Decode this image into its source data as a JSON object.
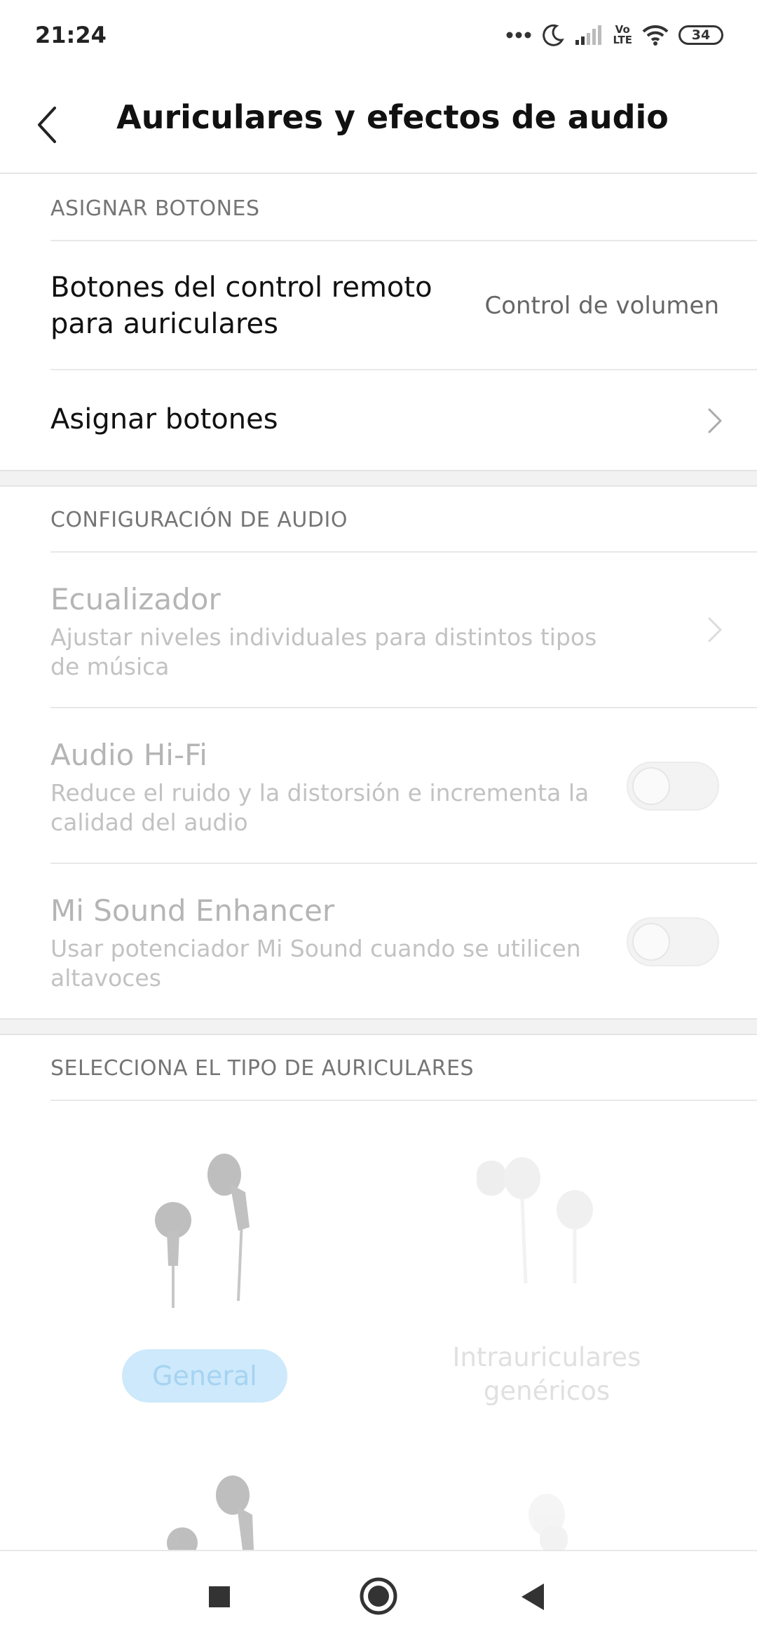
{
  "status_bar": {
    "time": "21:24",
    "volte_top": "Vo",
    "volte_bottom": "LTE",
    "battery": "34"
  },
  "app_bar": {
    "title": "Auriculares y efectos de audio",
    "back_icon": "chevron-left-icon"
  },
  "section_buttons": {
    "header": "ASIGNAR BOTONES",
    "remote_title_line1": "Botones del control remoto",
    "remote_title_line2": "para auriculares",
    "remote_value": "Control de volumen",
    "assign_title": "Asignar botones"
  },
  "section_audio": {
    "header": "CONFIGURACIÓN DE AUDIO",
    "equalizer": {
      "title": "Ecualizador",
      "subtitle": "Ajustar niveles individuales para distintos tipos de música"
    },
    "hifi": {
      "title": "Audio Hi-Fi",
      "subtitle": "Reduce el ruido y la distorsión e incrementa la calidad del audio",
      "enabled": false
    },
    "enhancer": {
      "title": "Mi Sound Enhancer",
      "subtitle": "Usar potenciador Mi Sound cuando se utilicen altavoces",
      "enabled": false
    }
  },
  "section_type": {
    "header": "SELECCIONA EL TIPO DE AURICULARES",
    "option_general": "General",
    "option_intra_line1": "Intrauriculares",
    "option_intra_line2": "genéricos"
  },
  "colors": {
    "accent_disabled": "#cde9fb",
    "text_disabled": "#b5b5b5"
  }
}
